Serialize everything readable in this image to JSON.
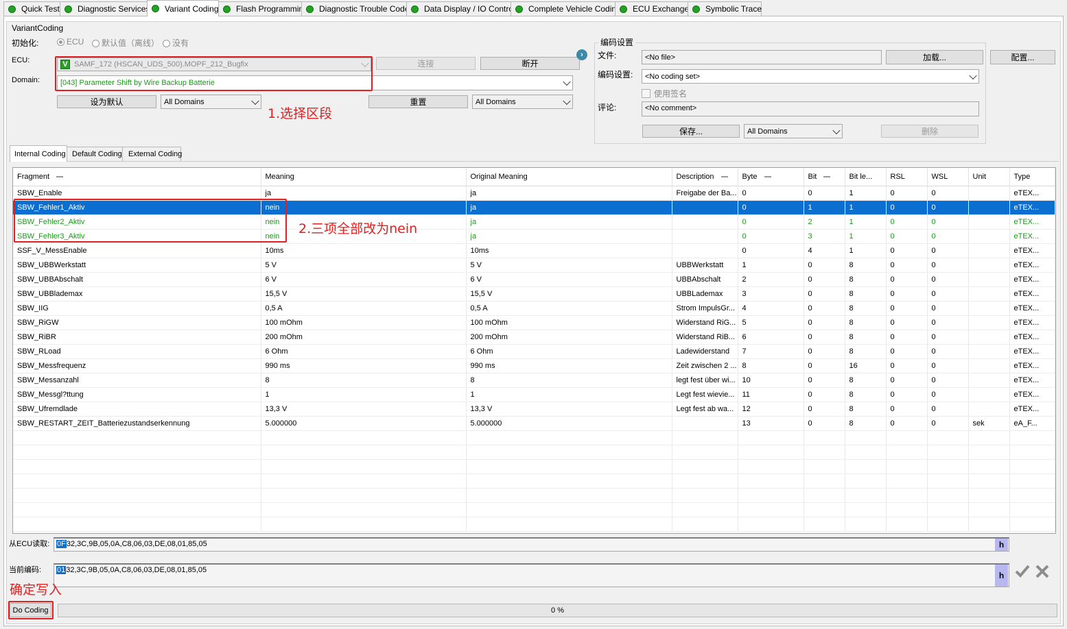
{
  "tabs": [
    "Quick Test",
    "Diagnostic Services",
    "Variant Coding",
    "Flash Programming",
    "Diagnostic Trouble Code",
    "Data Display / IO Control",
    "Complete Vehicle Coding",
    "ECU Exchange",
    "Symbolic Trace"
  ],
  "active_tab": "Variant Coding",
  "panel_title": "VariantCoding",
  "init": {
    "label": "初始化:",
    "options": [
      "ECU",
      "默认值（离线）",
      "没有"
    ],
    "selected": "ECU"
  },
  "ecu": {
    "label": "ECU:",
    "badge": "V",
    "value": "SAMF_172 (HSCAN_UDS_500).MOPF_212_Bugfix",
    "connect_label": "连接",
    "disconnect_label": "断开"
  },
  "domain": {
    "label": "Domain:",
    "value": "[043] Parameter Shift by Wire Backup Batterie"
  },
  "row3": {
    "set_default_label": "设为默认",
    "filter1": "All Domains",
    "reset_label": "重置",
    "filter2": "All Domains"
  },
  "coding_settings": {
    "title": "编码设置",
    "file_label": "文件:",
    "file_value": "<No file>",
    "load_label": "加载...",
    "config_label": "配置...",
    "set_label": "编码设置:",
    "set_value": "<No coding set>",
    "use_signature_label": "使用签名",
    "comment_label": "评论:",
    "comment_value": "<No comment>",
    "save_label": "保存...",
    "domains_value": "All Domains",
    "delete_label": "删除"
  },
  "subtabs": [
    "Internal Coding",
    "Default Coding",
    "External Coding"
  ],
  "active_subtab": "Internal Coding",
  "grid": {
    "columns": [
      "Fragment",
      "Meaning",
      "Original Meaning",
      "Description",
      "Byte",
      "Bit",
      "Bit le...",
      "RSL",
      "WSL",
      "Unit",
      "Type"
    ],
    "rows": [
      [
        "SBW_Enable",
        "ja",
        "ja",
        "Freigabe der Ba...",
        "0",
        "0",
        "1",
        "0",
        "0",
        "",
        "eTEX..."
      ],
      [
        "SBW_Fehler1_Aktiv",
        "nein",
        "ja",
        "",
        "0",
        "1",
        "1",
        "0",
        "0",
        "",
        "eTEX..."
      ],
      [
        "SBW_Fehler2_Aktiv",
        "nein",
        "ja",
        "",
        "0",
        "2",
        "1",
        "0",
        "0",
        "",
        "eTEX..."
      ],
      [
        "SBW_Fehler3_Aktiv",
        "nein",
        "ja",
        "",
        "0",
        "3",
        "1",
        "0",
        "0",
        "",
        "eTEX..."
      ],
      [
        "SSF_V_MessEnable",
        "10ms",
        "10ms",
        "",
        "0",
        "4",
        "1",
        "0",
        "0",
        "",
        "eTEX..."
      ],
      [
        "SBW_UBBWerkstatt",
        "5 V",
        "5 V",
        "UBBWerkstatt",
        "1",
        "0",
        "8",
        "0",
        "0",
        "",
        "eTEX..."
      ],
      [
        "SBW_UBBAbschalt",
        "6 V",
        "6 V",
        "UBBAbschalt",
        "2",
        "0",
        "8",
        "0",
        "0",
        "",
        "eTEX..."
      ],
      [
        "SBW_UBBlademax",
        "15,5 V",
        "15,5 V",
        "UBBLademax",
        "3",
        "0",
        "8",
        "0",
        "0",
        "",
        "eTEX..."
      ],
      [
        "SBW_IIG",
        "0,5 A",
        "0,5 A",
        "Strom ImpulsGr...",
        "4",
        "0",
        "8",
        "0",
        "0",
        "",
        "eTEX..."
      ],
      [
        "SBW_RiGW",
        "100 mOhm",
        "100 mOhm",
        "Widerstand RiG...",
        "5",
        "0",
        "8",
        "0",
        "0",
        "",
        "eTEX..."
      ],
      [
        "SBW_RiBR",
        "200 mOhm",
        "200 mOhm",
        "Widerstand RiB...",
        "6",
        "0",
        "8",
        "0",
        "0",
        "",
        "eTEX..."
      ],
      [
        "SBW_RLoad",
        "6 Ohm",
        "6 Ohm",
        "Ladewiderstand",
        "7",
        "0",
        "8",
        "0",
        "0",
        "",
        "eTEX..."
      ],
      [
        "SBW_Messfrequenz",
        "990 ms",
        "990 ms",
        "Zeit zwischen 2 ...",
        "8",
        "0",
        "16",
        "0",
        "0",
        "",
        "eTEX..."
      ],
      [
        "SBW_Messanzahl",
        "8",
        "8",
        "legt fest über wi...",
        "10",
        "0",
        "8",
        "0",
        "0",
        "",
        "eTEX..."
      ],
      [
        "SBW_Messgl?ttung",
        "1",
        "1",
        "Legt fest wievie...",
        "11",
        "0",
        "8",
        "0",
        "0",
        "",
        "eTEX..."
      ],
      [
        "SBW_Ufremdlade",
        "13,3 V",
        "13,3 V",
        "Legt fest ab wa...",
        "12",
        "0",
        "8",
        "0",
        "0",
        "",
        "eTEX..."
      ],
      [
        "SBW_RESTART_ZEIT_Batteriezustandserkennung",
        "5.000000",
        "5.000000",
        "",
        "13",
        "0",
        "8",
        "0",
        "0",
        "sek",
        "eA_F..."
      ]
    ],
    "empty_rows": 7
  },
  "ecu_read": {
    "label": "从ECU读取:",
    "first": "0F",
    "rest": "32,3C,9B,05,0A,C8,06,03,DE,08,01,85,05",
    "h": "h"
  },
  "current_coding": {
    "label": "当前编码:",
    "first": "01",
    "rest": "32,3C,9B,05,0A,C8,06,03,DE,08,01,85,05",
    "h": "h"
  },
  "do_coding_label": "Do Coding",
  "progress_text": "0 %",
  "annotations": {
    "step1": "1.选择区段",
    "step2": "2.三项全部改为nein",
    "step3": "确定写入"
  },
  "colors": {
    "selection": "#0a6fd1",
    "modified_text": "#1a9a1a",
    "annotation": "#e02020",
    "status_dot": "#23a323"
  }
}
